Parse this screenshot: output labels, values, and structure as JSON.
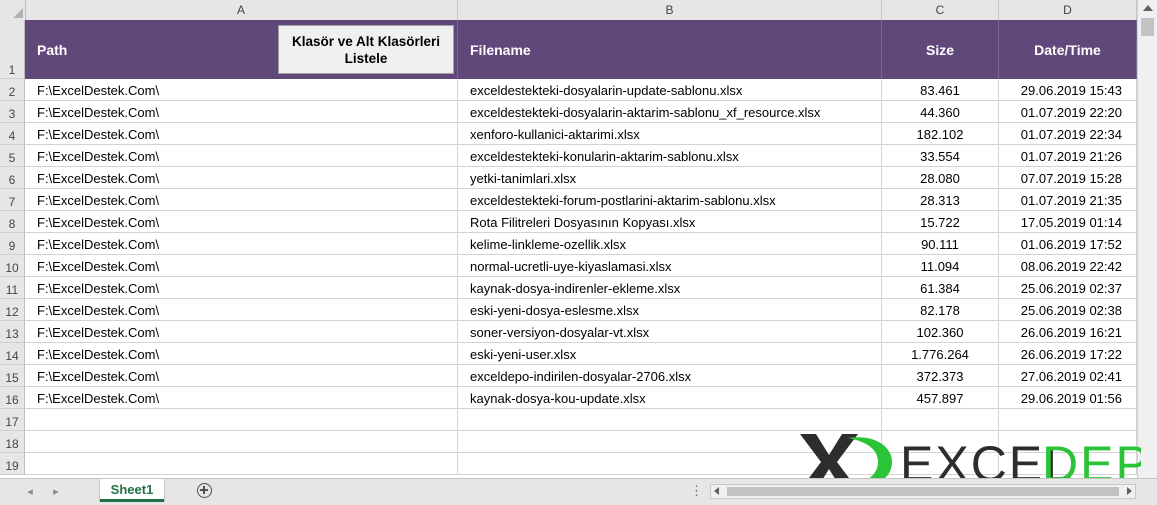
{
  "columns": [
    "A",
    "B",
    "C",
    "D"
  ],
  "rows": [
    "1",
    "2",
    "3",
    "4",
    "5",
    "6",
    "7",
    "8",
    "9",
    "10",
    "11",
    "12",
    "13",
    "14",
    "15",
    "16",
    "17",
    "18",
    "19"
  ],
  "header": {
    "path": "Path",
    "filename": "Filename",
    "size": "Size",
    "datetime": "Date/Time"
  },
  "button": {
    "label": "Klasör ve Alt Klasörleri Listele"
  },
  "data": [
    {
      "path": "F:\\ExcelDestek.Com\\",
      "filename": "exceldestekteki-dosyalarin-update-sablonu.xlsx",
      "size": "83.461",
      "date": "29.06.2019 15:43"
    },
    {
      "path": "F:\\ExcelDestek.Com\\",
      "filename": "exceldestekteki-dosyalarin-aktarim-sablonu_xf_resource.xlsx",
      "size": "44.360",
      "date": "01.07.2019 22:20"
    },
    {
      "path": "F:\\ExcelDestek.Com\\",
      "filename": "xenforo-kullanici-aktarimi.xlsx",
      "size": "182.102",
      "date": "01.07.2019 22:34"
    },
    {
      "path": "F:\\ExcelDestek.Com\\",
      "filename": "exceldestekteki-konularin-aktarim-sablonu.xlsx",
      "size": "33.554",
      "date": "01.07.2019 21:26"
    },
    {
      "path": "F:\\ExcelDestek.Com\\",
      "filename": "yetki-tanimlari.xlsx",
      "size": "28.080",
      "date": "07.07.2019 15:28"
    },
    {
      "path": "F:\\ExcelDestek.Com\\",
      "filename": "exceldestekteki-forum-postlarini-aktarim-sablonu.xlsx",
      "size": "28.313",
      "date": "01.07.2019 21:35"
    },
    {
      "path": "F:\\ExcelDestek.Com\\",
      "filename": "Rota Filitreleri Dosyasının Kopyası.xlsx",
      "size": "15.722",
      "date": "17.05.2019 01:14"
    },
    {
      "path": "F:\\ExcelDestek.Com\\",
      "filename": "kelime-linkleme-ozellik.xlsx",
      "size": "90.111",
      "date": "01.06.2019 17:52"
    },
    {
      "path": "F:\\ExcelDestek.Com\\",
      "filename": "normal-ucretli-uye-kiyaslamasi.xlsx",
      "size": "11.094",
      "date": "08.06.2019 22:42"
    },
    {
      "path": "F:\\ExcelDestek.Com\\",
      "filename": "kaynak-dosya-indirenler-ekleme.xlsx",
      "size": "61.384",
      "date": "25.06.2019 02:37"
    },
    {
      "path": "F:\\ExcelDestek.Com\\",
      "filename": "eski-yeni-dosya-eslesme.xlsx",
      "size": "82.178",
      "date": "25.06.2019 02:38"
    },
    {
      "path": "F:\\ExcelDestek.Com\\",
      "filename": "soner-versiyon-dosyalar-vt.xlsx",
      "size": "102.360",
      "date": "26.06.2019 16:21"
    },
    {
      "path": "F:\\ExcelDestek.Com\\",
      "filename": "eski-yeni-user.xlsx",
      "size": "1.776.264",
      "date": "26.06.2019 17:22"
    },
    {
      "path": "F:\\ExcelDestek.Com\\",
      "filename": "exceldepo-indirilen-dosyalar-2706.xlsx",
      "size": "372.373",
      "date": "27.06.2019 02:41"
    },
    {
      "path": "F:\\ExcelDestek.Com\\",
      "filename": "kaynak-dosya-kou-update.xlsx",
      "size": "457.897",
      "date": "29.06.2019 01:56"
    }
  ],
  "sheet_tab": "Sheet1",
  "logo": {
    "part1": "EXCEL",
    "part2": "DEPO"
  },
  "colors": {
    "header": "#60497a",
    "tab": "#217346",
    "logo_green": "#2bc338",
    "logo_dark": "#2d2d2d"
  }
}
